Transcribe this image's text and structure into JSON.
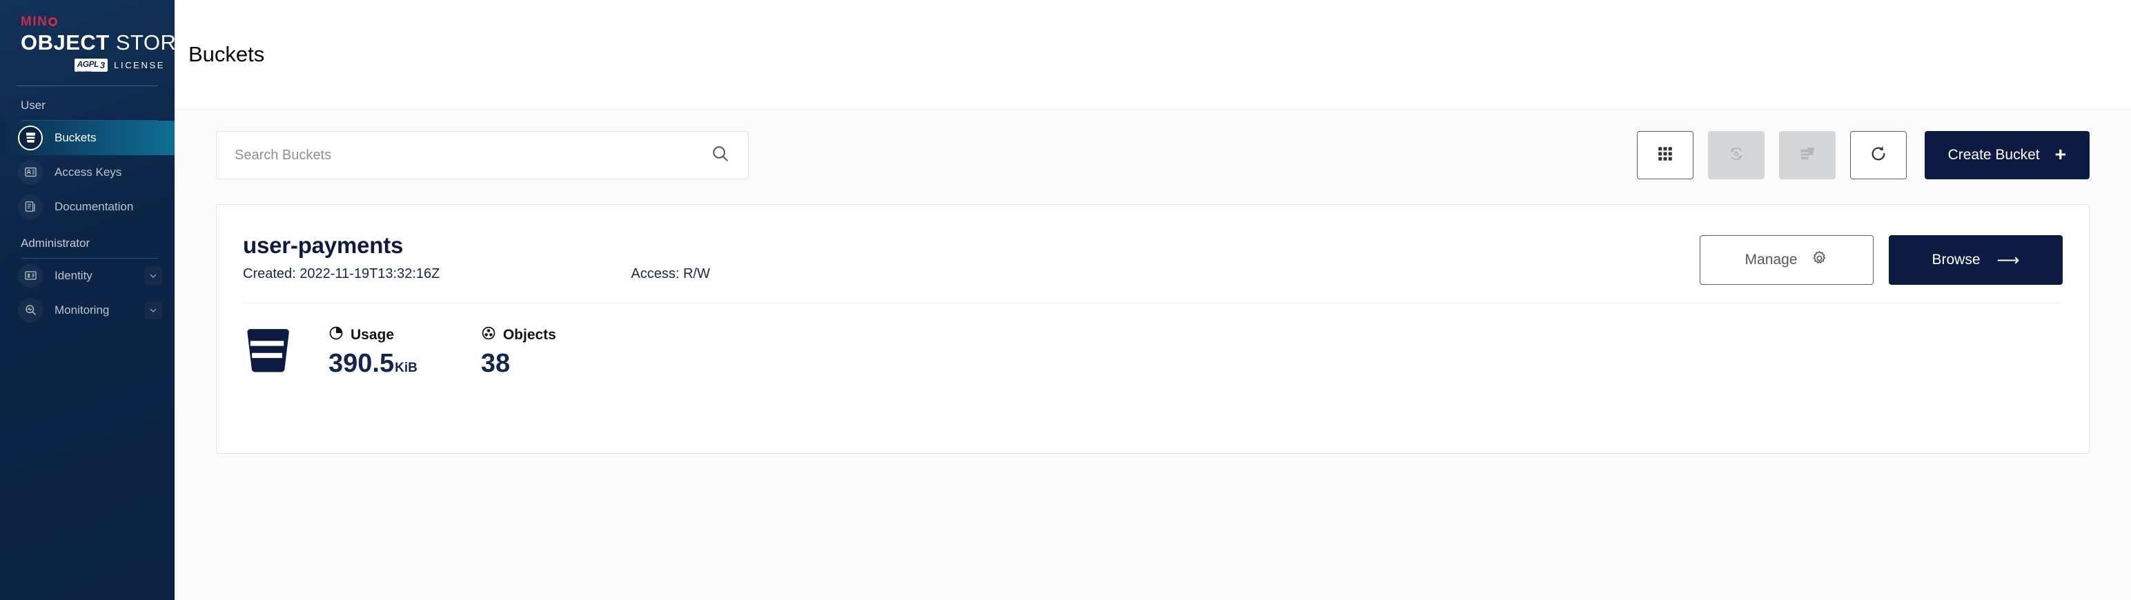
{
  "sidebar": {
    "logo": {
      "brand": "MIN",
      "brand_suffix": "IO",
      "title_bold": "OBJECT",
      "title_thin": "STORE",
      "license_badge": "AGPL",
      "license_badge_sub": "Free Software",
      "license_badge_version": "3",
      "license_word": "LICENSE"
    },
    "groups": [
      {
        "label": "User",
        "items": [
          {
            "label": "Buckets",
            "icon": "bucket-icon",
            "active": true,
            "expandable": false
          },
          {
            "label": "Access Keys",
            "icon": "access-keys-icon",
            "active": false,
            "expandable": false
          },
          {
            "label": "Documentation",
            "icon": "documentation-icon",
            "active": false,
            "expandable": false
          }
        ]
      },
      {
        "label": "Administrator",
        "items": [
          {
            "label": "Identity",
            "icon": "identity-icon",
            "active": false,
            "expandable": true
          },
          {
            "label": "Monitoring",
            "icon": "monitoring-icon",
            "active": false,
            "expandable": true
          }
        ]
      }
    ]
  },
  "header": {
    "title": "Buckets"
  },
  "toolbar": {
    "search": {
      "placeholder": "Search Buckets",
      "value": "",
      "icon": "search-icon"
    },
    "buttons": [
      {
        "name": "grid-view-button",
        "icon": "grid-icon",
        "state": "enabled"
      },
      {
        "name": "replication-sync-button",
        "icon": "sync-icon",
        "state": "disabled"
      },
      {
        "name": "delete-buckets-button",
        "icon": "delete-buckets-icon",
        "state": "disabled"
      },
      {
        "name": "refresh-button",
        "icon": "refresh-icon",
        "state": "enabled"
      }
    ],
    "create_label": "Create Bucket",
    "create_icon": "plus-icon"
  },
  "buckets": [
    {
      "name": "user-payments",
      "created_label": "Created: 2022-11-19T13:32:16Z",
      "access_label": "Access: R/W",
      "manage_label": "Manage",
      "manage_icon": "gear-icon",
      "browse_label": "Browse",
      "browse_icon": "arrow-right-icon",
      "stats": [
        {
          "label": "Usage",
          "icon": "usage-pie-icon",
          "value": "390.5",
          "unit": "KiB"
        },
        {
          "label": "Objects",
          "icon": "objects-icon",
          "value": "38",
          "unit": ""
        }
      ]
    }
  ],
  "colors": {
    "sidebar_dark": "#0b2240",
    "sidebar_active_teal": "#0e6f93",
    "brand_red": "#c72c48",
    "navy": "#0d1b42",
    "page_bg": "#fbfbfc",
    "card_border": "#e3e6e9"
  }
}
